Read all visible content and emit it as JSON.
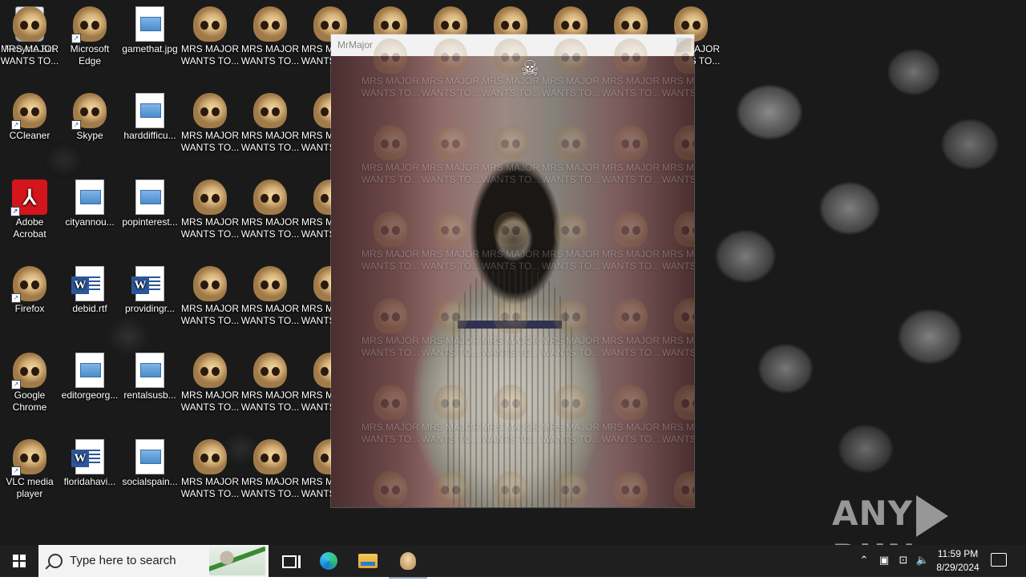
{
  "desktop": {
    "icons": [
      {
        "label": "Recycle Bin",
        "type": "recycle"
      },
      {
        "label": "Microsoft Edge",
        "type": "skull"
      },
      {
        "label": "gamethat.jpg",
        "type": "image"
      },
      {
        "label": "MRS MAJOR WANTS TO...",
        "type": "skull"
      },
      {
        "label": "MRS MAJOR WANTS TO...",
        "type": "skull"
      },
      {
        "label": "MRS MAJOR WANTS TO...",
        "type": "skull"
      },
      {
        "label": "CCleaner",
        "type": "skull"
      },
      {
        "label": "Skype",
        "type": "skull"
      },
      {
        "label": "harddifficu...",
        "type": "image"
      },
      {
        "label": "MRS MAJOR WANTS TO...",
        "type": "skull"
      },
      {
        "label": "MRS MAJOR WANTS TO...",
        "type": "skull"
      },
      {
        "label": "MRS MAJOR WANTS TO...",
        "type": "skull"
      },
      {
        "label": "Adobe Acrobat",
        "type": "acrobat"
      },
      {
        "label": "cityannou...",
        "type": "image"
      },
      {
        "label": "popinterest...",
        "type": "image"
      },
      {
        "label": "MRS MAJOR WANTS TO...",
        "type": "skull"
      },
      {
        "label": "MRS MAJOR WANTS TO...",
        "type": "skull"
      },
      {
        "label": "MRS MAJOR WANTS TO...",
        "type": "skull"
      },
      {
        "label": "Firefox",
        "type": "skull"
      },
      {
        "label": "debid.rtf",
        "type": "word"
      },
      {
        "label": "providingr...",
        "type": "word"
      },
      {
        "label": "MRS MAJOR WANTS TO...",
        "type": "skull"
      },
      {
        "label": "MRS MAJOR WANTS TO...",
        "type": "skull"
      },
      {
        "label": "MRS MAJOR WANTS TO...",
        "type": "skull"
      },
      {
        "label": "Google Chrome",
        "type": "skull"
      },
      {
        "label": "editorgeorg...",
        "type": "image"
      },
      {
        "label": "rentalsusb...",
        "type": "image"
      },
      {
        "label": "MRS MAJOR WANTS TO...",
        "type": "skull"
      },
      {
        "label": "MRS MAJOR WANTS TO...",
        "type": "skull"
      },
      {
        "label": "MRS MAJOR WANTS TO...",
        "type": "skull"
      },
      {
        "label": "VLC media player",
        "type": "skull"
      },
      {
        "label": "floridahavi...",
        "type": "word"
      },
      {
        "label": "socialspain...",
        "type": "image"
      },
      {
        "label": "MRS MAJOR WANTS TO...",
        "type": "skull"
      },
      {
        "label": "MRS MAJOR WANTS TO...",
        "type": "skull"
      },
      {
        "label": "MRS MAJOR WANTS TO...",
        "type": "skull"
      },
      {
        "label": "MRS MAJOR WANTS TO...",
        "type": "skull"
      },
      {
        "label": "MRS MAJOR WANTS TO...",
        "type": "skull"
      },
      {
        "label": "MRS MAJOR WANTS TO...",
        "type": "skull"
      },
      {
        "label": "MRS MAJOR WANTS TO...",
        "type": "skull"
      },
      {
        "label": "MRS MAJOR WANTS TO...",
        "type": "skull"
      },
      {
        "label": "MRS MAJOR WANTS TO...",
        "type": "skull"
      },
      {
        "label": "MRS MAJOR WANTS TO...",
        "type": "skull"
      }
    ]
  },
  "window": {
    "title": "MrMajor",
    "cursor_icon": "skull-crossbones-icon"
  },
  "watermark": {
    "left": "ANY",
    "right": "RUN"
  },
  "taskbar": {
    "search_placeholder": "Type here to search",
    "time": "11:59 PM",
    "date": "8/29/2024",
    "tray_icons": [
      "chevron-up-icon",
      "meet-now-icon",
      "network-icon",
      "volume-icon"
    ]
  },
  "colors": {
    "taskbar_bg": "#1f1f1f",
    "skull_bone": "#d6b27a",
    "acrobat_red": "#d4151b",
    "word_blue": "#2b579a"
  }
}
